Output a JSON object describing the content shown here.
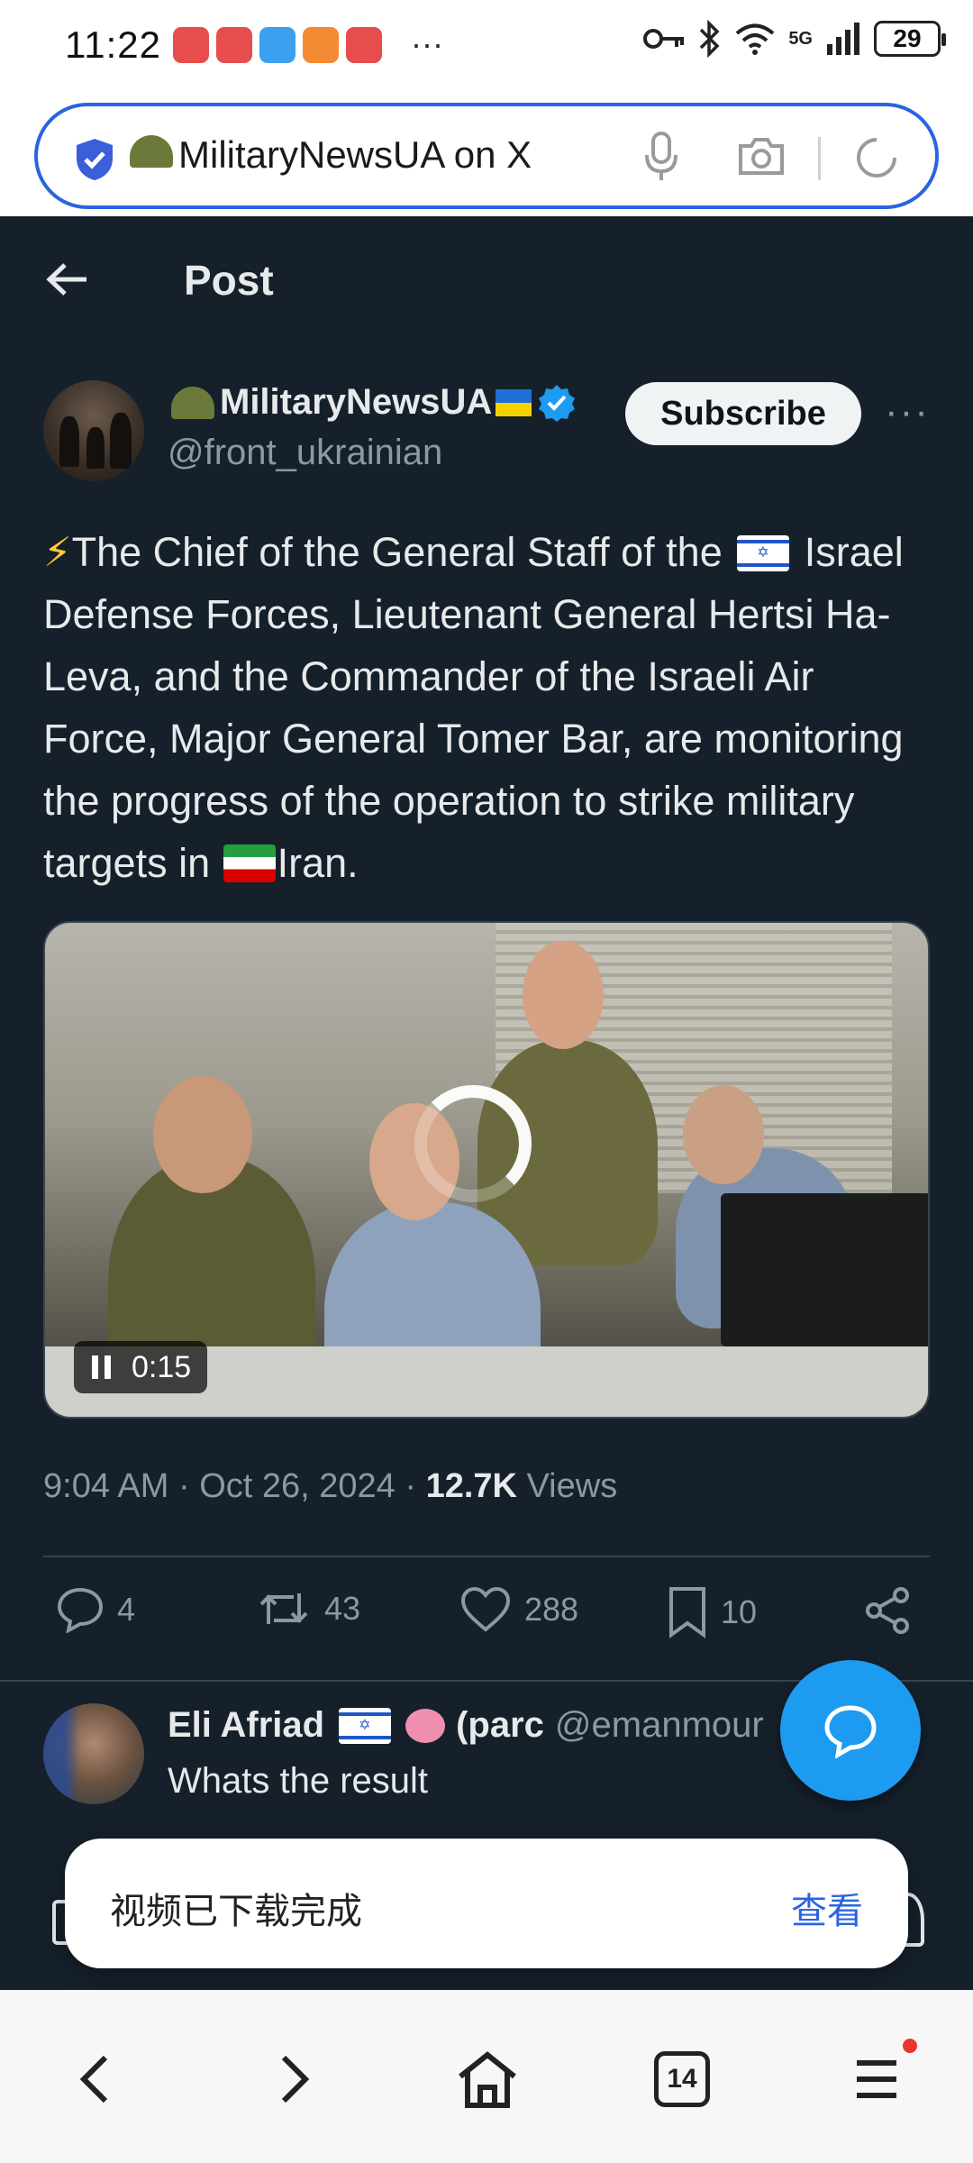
{
  "status_bar": {
    "time": "11:22",
    "more": "···",
    "network": "5G",
    "battery": "29",
    "app_icons": [
      "red-app-icon",
      "red-app-icon",
      "weather-app-icon",
      "video-app-icon",
      "red-app-icon"
    ]
  },
  "browser": {
    "url_text": "MilitaryNewsUA on X"
  },
  "header": {
    "title": "Post"
  },
  "post": {
    "author_name": "MilitaryNewsUA",
    "author_handle": "@front_ukrainian",
    "subscribe_label": "Subscribe",
    "text_1": "The Chief of the General Staff of the",
    "text_2": "Israel Defense Forces, Lieutenant General Hertsi Ha-Leva, and the Commander of the Israeli Air Force, Major General Tomer Bar, are monitoring the progress of the operation to strike military targets in",
    "text_3": "Iran.",
    "video_time": "0:15",
    "meta_time": "9:04 AM · Oct 26, 2024 · ",
    "views_count": "12.7K",
    "views_label": " Views",
    "actions": {
      "replies": "4",
      "reposts": "43",
      "likes": "288",
      "bookmarks": "10"
    }
  },
  "reply": {
    "name": "Eli Afriad",
    "name_suffix": "(parc",
    "handle": "@emanmour",
    "text": "Whats the result"
  },
  "toast": {
    "message": "视频已下载完成",
    "action": "查看"
  },
  "nav": {
    "tabs_count": "14"
  },
  "colors": {
    "page_bg": "#15202b",
    "accent": "#1d9bf0",
    "browser_accent": "#2a64e0"
  }
}
